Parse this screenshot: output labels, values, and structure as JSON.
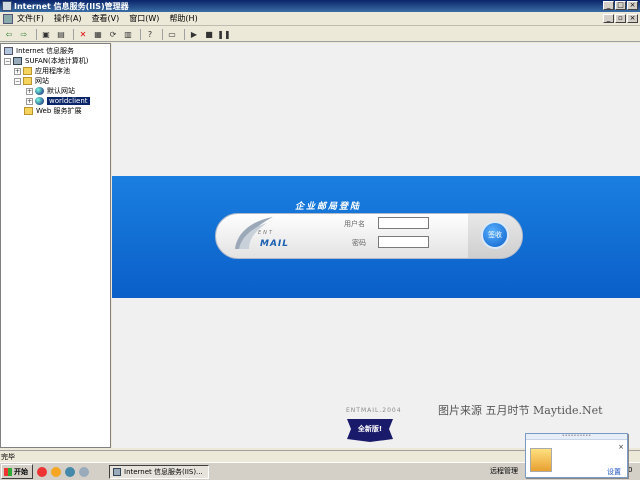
{
  "window": {
    "title": "Internet 信息服务(IIS)管理器"
  },
  "menu": [
    "文件(F)",
    "操作(A)",
    "查看(V)",
    "窗口(W)",
    "帮助(H)"
  ],
  "tree": {
    "root": "Internet 信息服务",
    "server": "SUFAN(本地计算机)",
    "app_pools": "应用程序池",
    "sites": "网站",
    "default_site": "默认网站",
    "selected_site": "worldclient",
    "web_ext": "Web 服务扩展"
  },
  "login": {
    "title": "企业邮局登陆",
    "logo": "MAIL",
    "logo_small": "ENT",
    "username_label": "用户名",
    "password_label": "密码",
    "signin": "签收",
    "version": "ENTMAIL.2004",
    "badge": "全新版!"
  },
  "watermark": "图片来源 五月时节 Maytide.Net",
  "status": "完毕",
  "taskbar": {
    "start": "开始",
    "task": "Internet 信息服务(IIS)...",
    "remote": "远程管理",
    "clock": "0"
  },
  "popup": {
    "settings": "设置",
    "close": "×"
  },
  "colors": {
    "band": "#0a6fd8",
    "titlebar": "#0a246a",
    "selection": "#0a246a"
  }
}
